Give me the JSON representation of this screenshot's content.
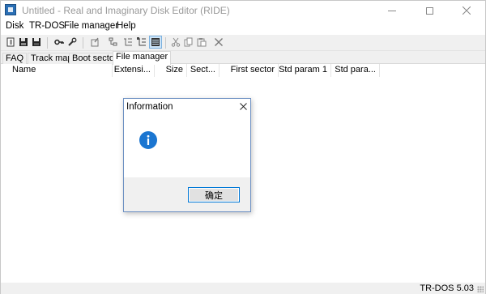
{
  "window": {
    "title": "Untitled - Real and Imaginary Disk Editor (RIDE)"
  },
  "menu": {
    "items": [
      "Disk",
      "TR-DOS",
      "File manager",
      "Help"
    ]
  },
  "toolbar": {
    "icons": [
      "new-disk-icon",
      "open-disk-icon",
      "save-disk-icon",
      "key-icon",
      "wrench-icon",
      "disk-tool-icon",
      "tree-view-icon",
      "tree-expand-icon",
      "tree-collapse-icon",
      "list-view-icon",
      "cut-icon",
      "copy-icon",
      "paste-icon",
      "delete-icon"
    ],
    "active_icon": "list-view-icon"
  },
  "tabs": [
    {
      "label": "FAQ"
    },
    {
      "label": "Track map"
    },
    {
      "label": "Boot sector"
    },
    {
      "label": "File manager",
      "selected": true
    }
  ],
  "columns": [
    "Name",
    "Extensi...",
    "Size",
    "Sect...",
    "First sector",
    "Std param 1",
    "Std para..."
  ],
  "status": {
    "text": "TR-DOS 5.03"
  },
  "dialog": {
    "title": "Information",
    "icon": "info-icon",
    "ok_label": "确定"
  },
  "colors": {
    "accent": "#0078d7",
    "info_icon": "#1b76d1",
    "chrome": "#f0f0f0"
  }
}
